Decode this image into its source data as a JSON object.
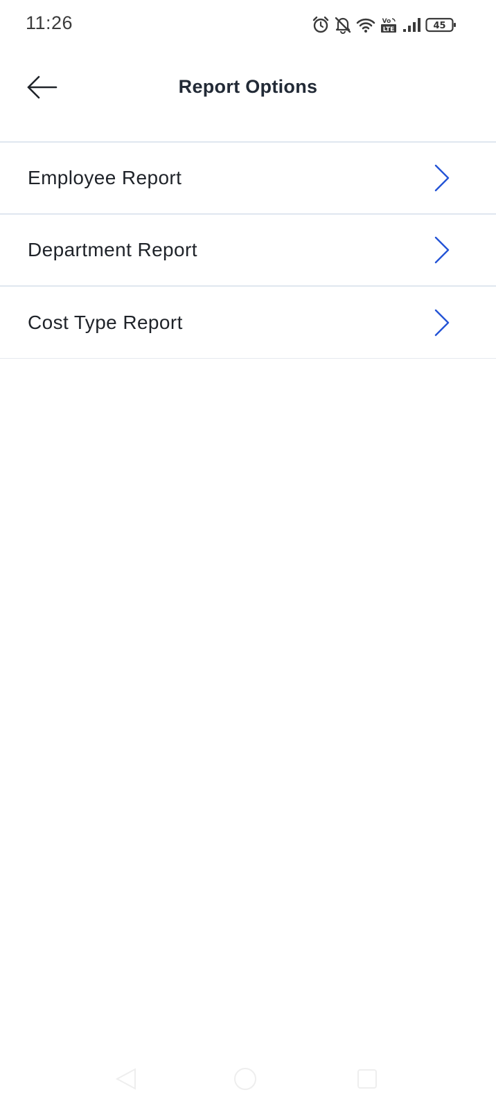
{
  "status_bar": {
    "time": "11:26",
    "battery_level": "45",
    "icons": [
      "alarm-icon",
      "bell-off-icon",
      "wifi-icon",
      "volte-icon",
      "signal-icon",
      "battery-icon"
    ]
  },
  "header": {
    "title": "Report Options",
    "back_icon": "arrow-left-icon"
  },
  "menu": {
    "items": [
      {
        "label": "Employee Report",
        "icon": "chevron-right-icon"
      },
      {
        "label": "Department Report",
        "icon": "chevron-right-icon"
      },
      {
        "label": "Cost Type Report",
        "icon": "chevron-right-icon"
      }
    ]
  },
  "colors": {
    "accent": "#2454d6",
    "divider": "#dfe6ef",
    "title_text": "#222a36",
    "body_text": "#1f2329"
  },
  "nav_bar": {
    "buttons": [
      "back-triangle-icon",
      "home-circle-icon",
      "recent-square-icon"
    ]
  }
}
